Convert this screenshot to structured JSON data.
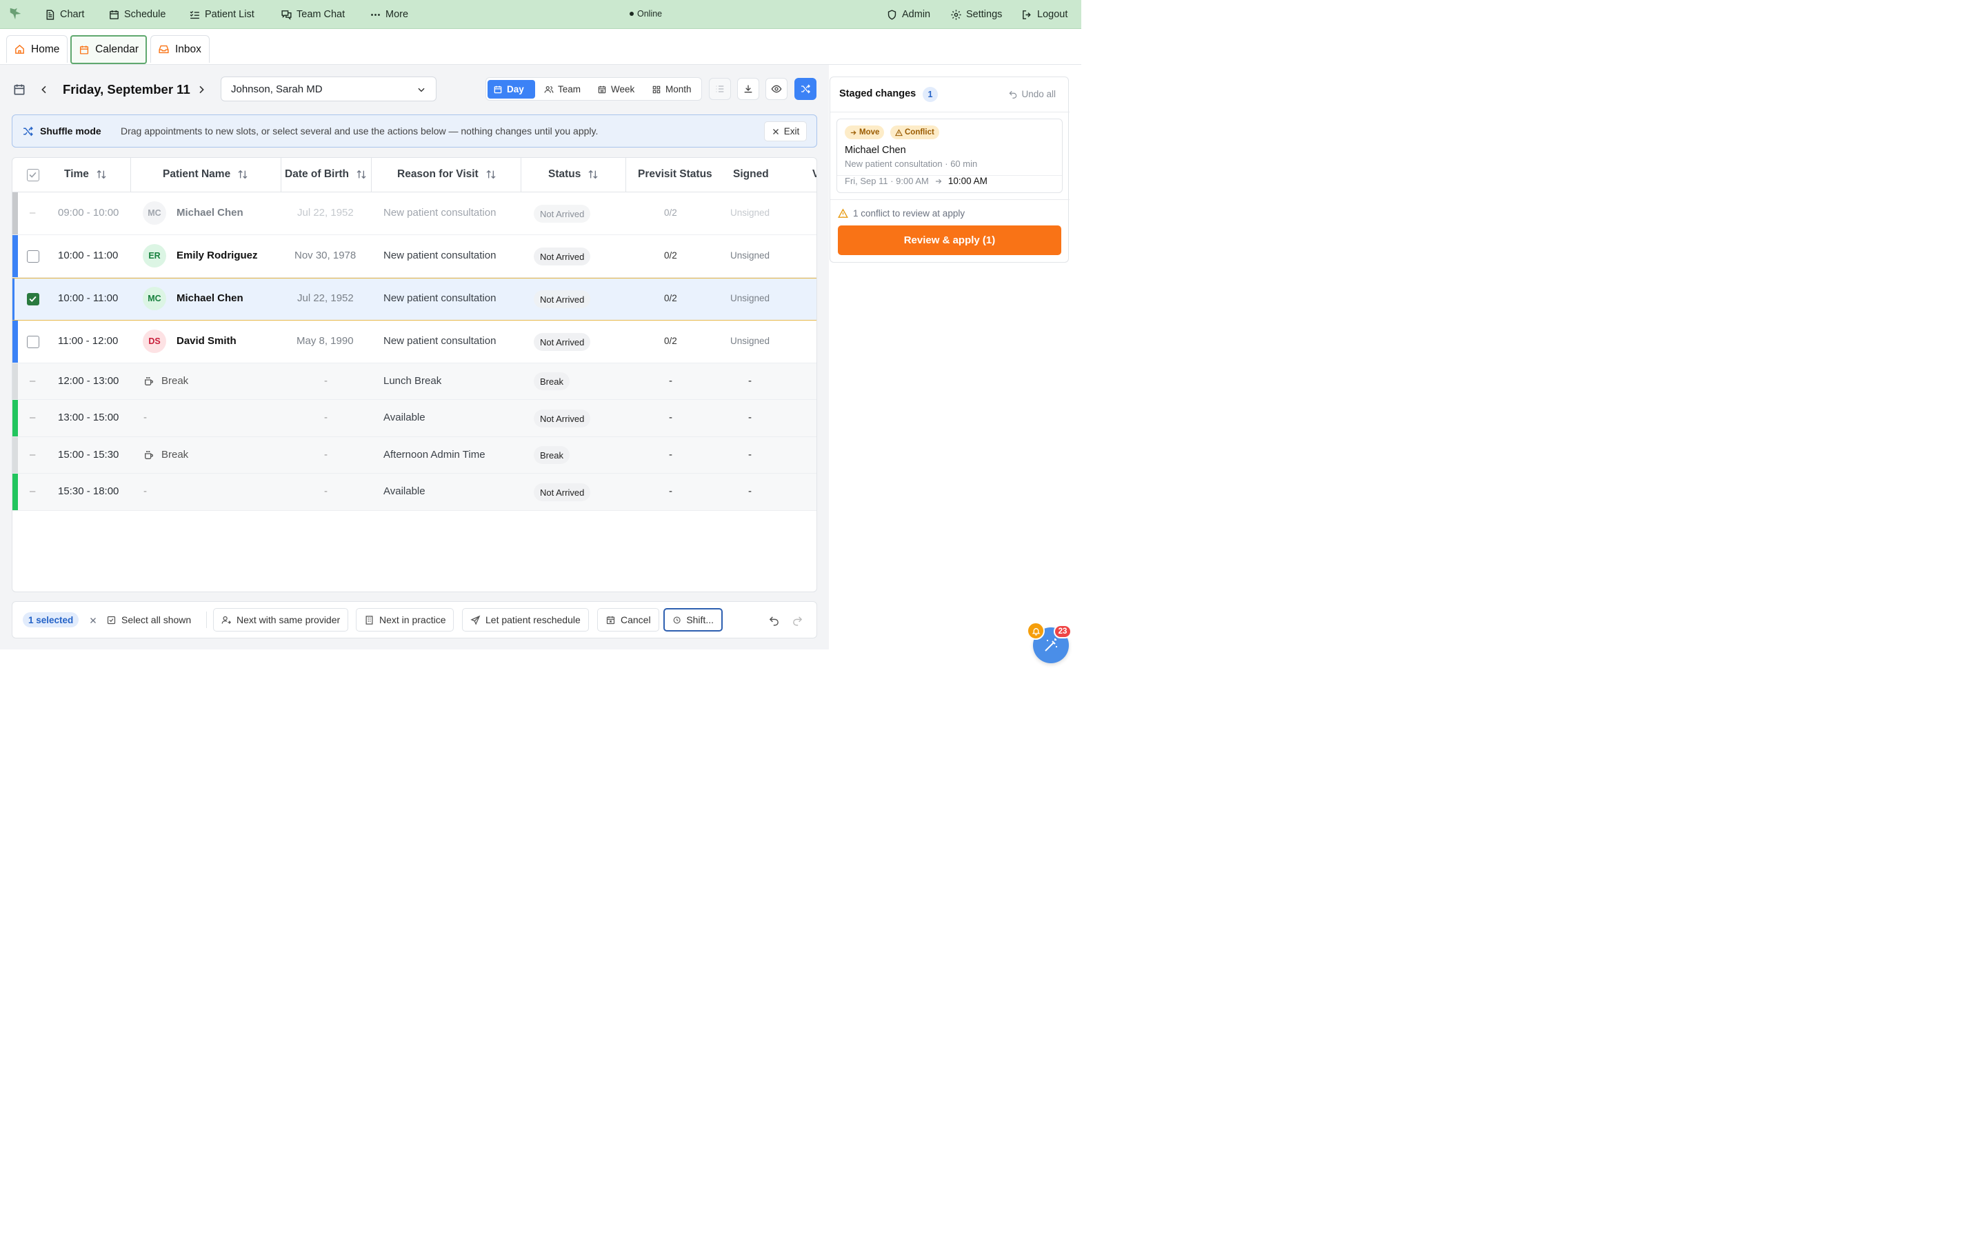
{
  "topnav": {
    "items": [
      {
        "label": "Chart",
        "icon": "document-icon"
      },
      {
        "label": "Schedule",
        "icon": "calendar-icon"
      },
      {
        "label": "Patient List",
        "icon": "list-check-icon"
      },
      {
        "label": "Team Chat",
        "icon": "chat-icon"
      },
      {
        "label": "More",
        "icon": "ellipsis-icon"
      }
    ],
    "status": "Online",
    "right": [
      {
        "label": "Admin",
        "icon": "shield-icon"
      },
      {
        "label": "Settings",
        "icon": "gear-icon"
      },
      {
        "label": "Logout",
        "icon": "logout-icon"
      }
    ]
  },
  "tabs": [
    {
      "label": "Home",
      "icon": "home-icon"
    },
    {
      "label": "Calendar",
      "icon": "calendar-icon",
      "active": true
    },
    {
      "label": "Inbox",
      "icon": "inbox-icon"
    }
  ],
  "toolbar": {
    "date": "Friday, September 11",
    "provider": "Johnson, Sarah MD",
    "views": [
      {
        "label": "Day",
        "active": true
      },
      {
        "label": "Team"
      },
      {
        "label": "Week"
      },
      {
        "label": "Month"
      }
    ]
  },
  "banner": {
    "title": "Shuffle mode",
    "text": "Drag appointments to new slots, or select several and use the actions below — nothing changes until you apply.",
    "exit": "Exit"
  },
  "table": {
    "headers": [
      "Time",
      "Patient Name",
      "Date of Birth",
      "Reason for Visit",
      "Status",
      "Previsit Status",
      "Signed",
      "V"
    ],
    "rows": [
      {
        "time": "09:00 - 10:00",
        "initials": "MC",
        "name": "Michael Chen",
        "dob": "Jul 22, 1952",
        "reason": "New patient consultation",
        "status": "Not Arrived",
        "previsit": "0/2",
        "signed": "Unsigned",
        "kind": "ghost",
        "check": "–"
      },
      {
        "time": "10:00 - 11:00",
        "initials": "ER",
        "name": "Emily Rodriguez",
        "dob": "Nov 30, 1978",
        "reason": "New patient consultation",
        "status": "Not Arrived",
        "previsit": "0/2",
        "signed": "Unsigned",
        "kind": "appt"
      },
      {
        "time": "10:00 - 11:00",
        "initials": "MC",
        "name": "Michael Chen",
        "dob": "Jul 22, 1952",
        "reason": "New patient consultation",
        "status": "Not Arrived",
        "previsit": "0/2",
        "signed": "Unsigned",
        "kind": "selected"
      },
      {
        "time": "11:00 - 12:00",
        "initials": "DS",
        "name": "David Smith",
        "dob": "May 8, 1990",
        "reason": "New patient consultation",
        "status": "Not Arrived",
        "previsit": "0/2",
        "signed": "Unsigned",
        "kind": "appt"
      },
      {
        "time": "12:00 - 13:00",
        "name": "Break",
        "dob": "-",
        "reason": "Lunch Break",
        "status": "Break",
        "previsit": "-",
        "signed": "-",
        "kind": "break",
        "check": "–"
      },
      {
        "time": "13:00 - 15:00",
        "name": "-",
        "dob": "-",
        "reason": "Available",
        "status": "Not Arrived",
        "previsit": "-",
        "signed": "-",
        "kind": "avail",
        "check": "–"
      },
      {
        "time": "15:00 - 15:30",
        "name": "Break",
        "dob": "-",
        "reason": "Afternoon Admin Time",
        "status": "Break",
        "previsit": "-",
        "signed": "-",
        "kind": "break",
        "check": "–"
      },
      {
        "time": "15:30 - 18:00",
        "name": "-",
        "dob": "-",
        "reason": "Available",
        "status": "Not Arrived",
        "previsit": "-",
        "signed": "-",
        "kind": "avail",
        "check": "–"
      }
    ]
  },
  "actions": {
    "selected": "1 selected",
    "select_all": "Select all shown",
    "next_provider": "Next with same provider",
    "next_practice": "Next in practice",
    "reschedule": "Let patient reschedule",
    "cancel": "Cancel",
    "shift": "Shift..."
  },
  "staged": {
    "title": "Staged changes",
    "count": "1",
    "undo": "Undo all",
    "tag_move": "Move",
    "tag_conflict": "Conflict",
    "patient": "Michael Chen",
    "detail": "New patient consultation · 60 min",
    "from": "Fri, Sep 11 · 9:00 AM",
    "to": "10:00 AM",
    "conflict_note": "1 conflict to review at apply",
    "apply": "Review & apply (1)"
  },
  "floating": {
    "notifications": "23"
  },
  "colors": {
    "accent": "#3b82f6",
    "apply": "#f97316",
    "topbar": "#cbe8cf",
    "appt_bar": "#3b82f6",
    "avail_bar": "#22c55e",
    "break_bar": "#d9dcdf"
  }
}
